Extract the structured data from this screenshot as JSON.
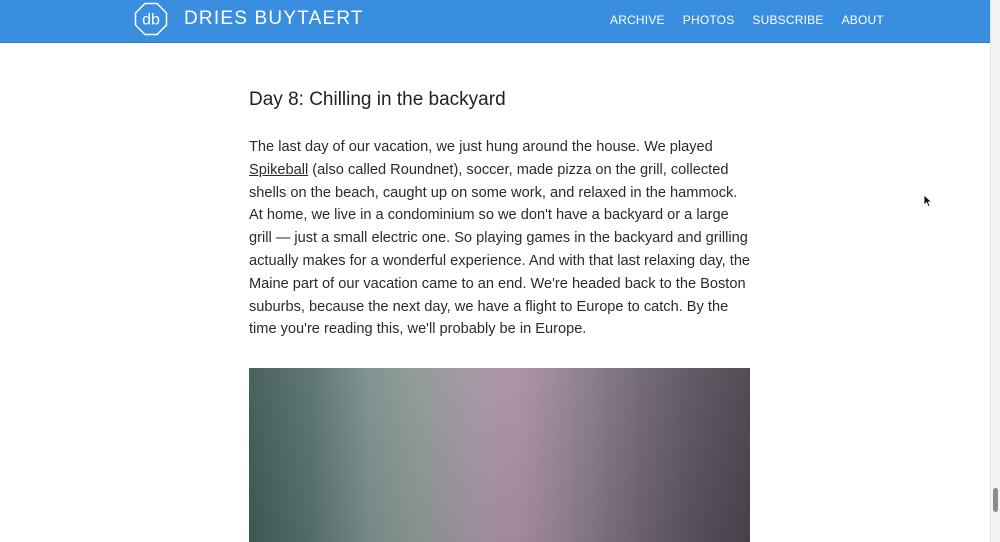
{
  "header": {
    "logo_mark": "db",
    "site_name": "DRIES BUYTAERT",
    "nav": [
      {
        "label": "ARCHIVE"
      },
      {
        "label": "PHOTOS"
      },
      {
        "label": "SUBSCRIBE"
      },
      {
        "label": "ABOUT"
      }
    ]
  },
  "article": {
    "heading": "Day 8: Chilling in the backyard",
    "paragraph_link": "Spikeball",
    "paragraph_before": "The last day of our vacation, we just hung around the house. We played ",
    "paragraph_after": " (also called Roundnet), soccer, made pizza on the grill, collected shells on the beach, caught up on some work, and relaxed in the hammock. At home, we live in a condominium so we don't have a backyard or a large grill — just a small electric one. So playing games in the backyard and grilling actually makes for a wonderful experience. And with that last relaxing day, the Maine part of our vacation came to an end. We're headed back to the Boston suburbs, because the next day, we have a flight to Europe to catch. By the time you're reading this, we'll probably be in Europe."
  },
  "colors": {
    "header_bg": "#3a8ee0",
    "header_text": "#ffffff",
    "body_text": "#2b2b2b"
  },
  "icons": {
    "logo": "octagon-db-logo",
    "cursor": "mouse-pointer"
  }
}
